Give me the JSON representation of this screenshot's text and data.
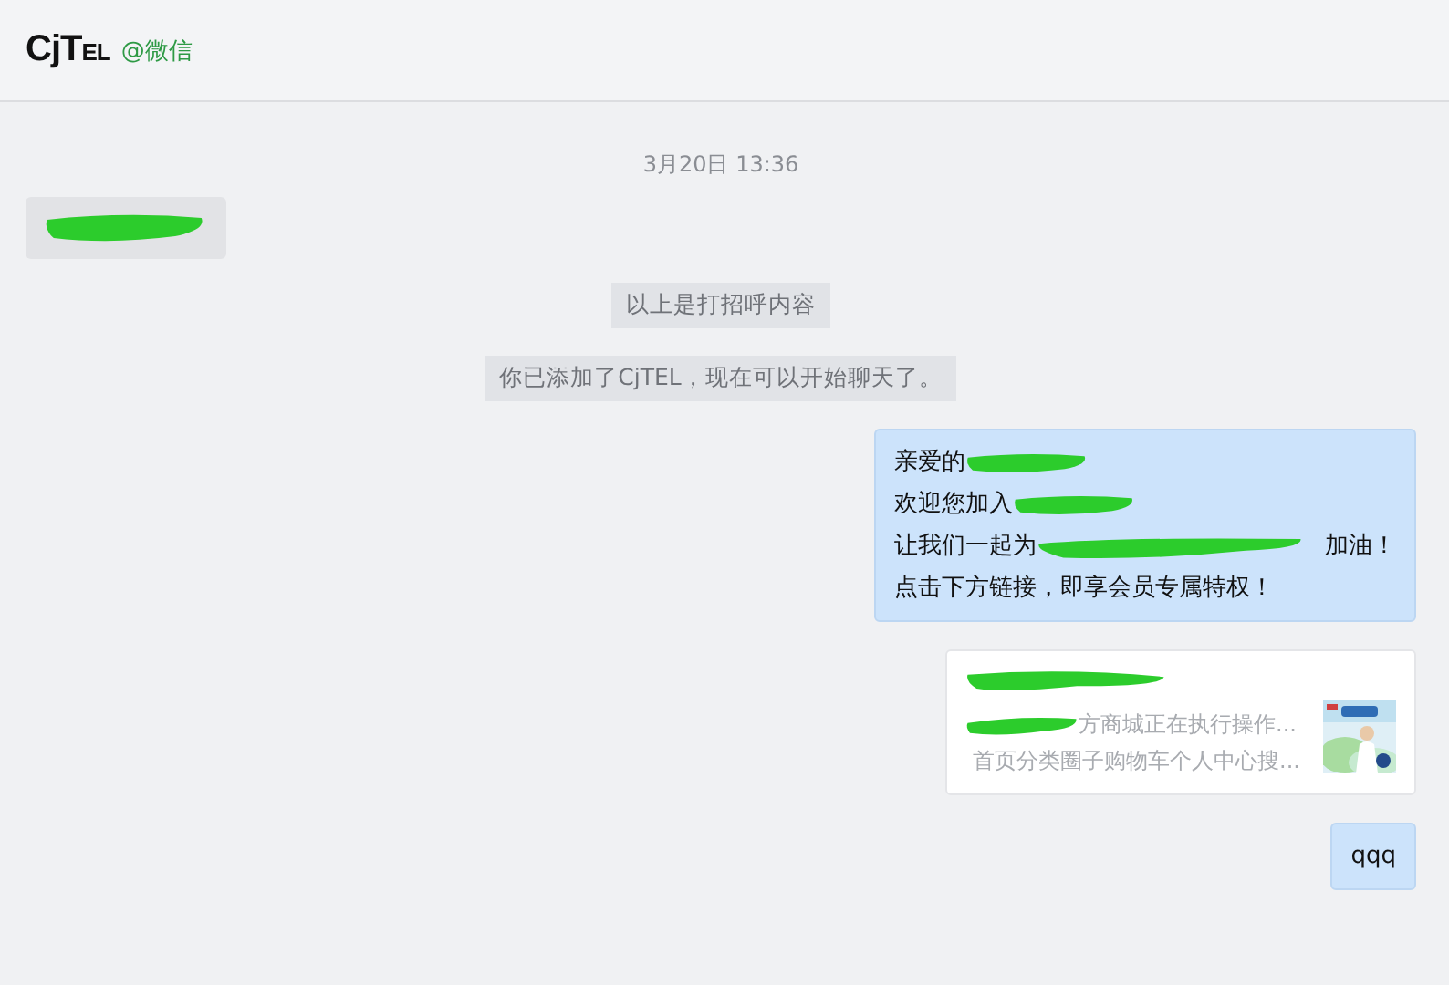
{
  "header": {
    "logo": {
      "main": "CjT",
      "small": "EL"
    },
    "account": "@微信"
  },
  "messages": [
    {
      "kind": "time",
      "text": "3月20日 13:36"
    },
    {
      "kind": "incoming",
      "lines": [
        [
          {
            "kind": "redacted"
          }
        ]
      ]
    },
    {
      "kind": "notice",
      "text": "以上是打招呼内容"
    },
    {
      "kind": "notice",
      "text": "你已添加了CjTEL，现在可以开始聊天了。"
    },
    {
      "kind": "outgoing",
      "lines": [
        [
          {
            "kind": "text",
            "text": "亲爱的"
          },
          {
            "kind": "redacted"
          }
        ],
        [
          {
            "kind": "text",
            "text": "欢迎您加入"
          },
          {
            "kind": "redacted"
          }
        ],
        [
          {
            "kind": "text",
            "text": "让我们一起为"
          },
          {
            "kind": "redacted_long"
          },
          {
            "kind": "text",
            "text": "加油！"
          }
        ],
        [
          {
            "kind": "text",
            "text": "点击下方链接，即享会员专属特权！"
          }
        ]
      ]
    },
    {
      "kind": "link_card",
      "desc": [
        "方商城正在执行操作...",
        "首页分类圈子购物车个人中心搜..."
      ],
      "thumbnail": {
        "kind": "picture"
      }
    },
    {
      "kind": "outgoing",
      "lines": [
        [
          {
            "kind": "text",
            "text": "qqq"
          }
        ]
      ]
    }
  ]
}
